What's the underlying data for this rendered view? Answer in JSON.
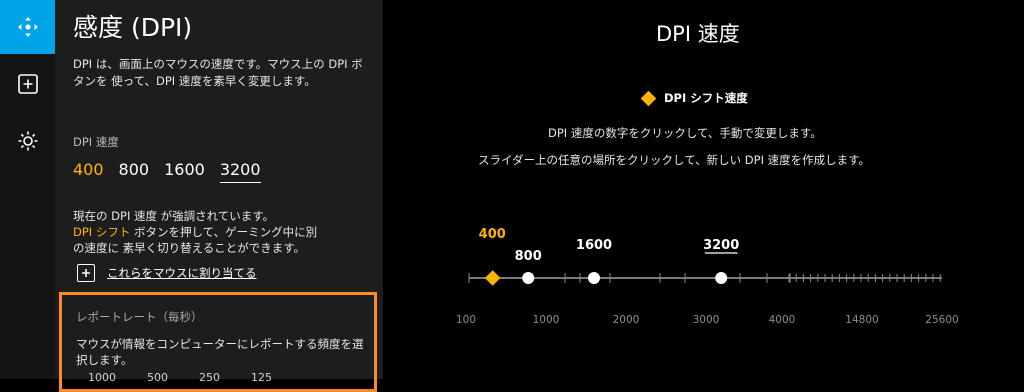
{
  "rail": [
    {
      "name": "move-arrows-icon",
      "active": true
    },
    {
      "name": "plus-box-icon",
      "active": false
    },
    {
      "name": "gear-icon",
      "active": false
    }
  ],
  "panel": {
    "title": "感度 (DPI)",
    "description": "DPI は、画面上のマウスの速度です。マウス上の DPI ボタンを 使って、DPI 速度を素早く変更します。",
    "dpi_label": "DPI 速度",
    "dpi_options": [
      {
        "label": "400",
        "state": "shift"
      },
      {
        "label": "800",
        "state": "normal"
      },
      {
        "label": "1600",
        "state": "normal"
      },
      {
        "label": "3200",
        "state": "current"
      }
    ],
    "info_line1": "現在の DPI 速度 が強調されています。",
    "info_highlight": "DPI シフト",
    "info_line2_rest": " ボタンを押して、ゲーミング中に別",
    "info_line3": "の速度に 素早く切り替えることができます。",
    "assign_label": "これらをマウスに割り当てる",
    "report": {
      "title": "レポートレート（毎秒）",
      "description": "マウスが情報をコンピューターにレポートする頻度を選択します。",
      "rates": [
        "1000",
        "500",
        "250",
        "125"
      ]
    }
  },
  "main": {
    "title": "DPI 速度",
    "legend": "DPI シフト速度",
    "instruction1": "DPI 速度の数字をクリックして、手動で変更します。",
    "instruction2": "スライダー上の任意の場所をクリックして、新しい DPI 速度を作成します。"
  },
  "colors": {
    "accent": "#00a2e8",
    "shift": "#ffb300",
    "highlight_border": "#ff8a1d"
  },
  "chart_data": {
    "type": "scatter",
    "x_scale": "custom piecewise",
    "axis_ticks": [
      100,
      1000,
      2000,
      3000,
      4000,
      14800,
      25600
    ],
    "points": [
      {
        "dpi": 400,
        "label": "400",
        "kind": "shift"
      },
      {
        "dpi": 800,
        "label": "800",
        "kind": "normal"
      },
      {
        "dpi": 1600,
        "label": "1600",
        "kind": "normal"
      },
      {
        "dpi": 3200,
        "label": "3200",
        "kind": "current"
      }
    ]
  }
}
